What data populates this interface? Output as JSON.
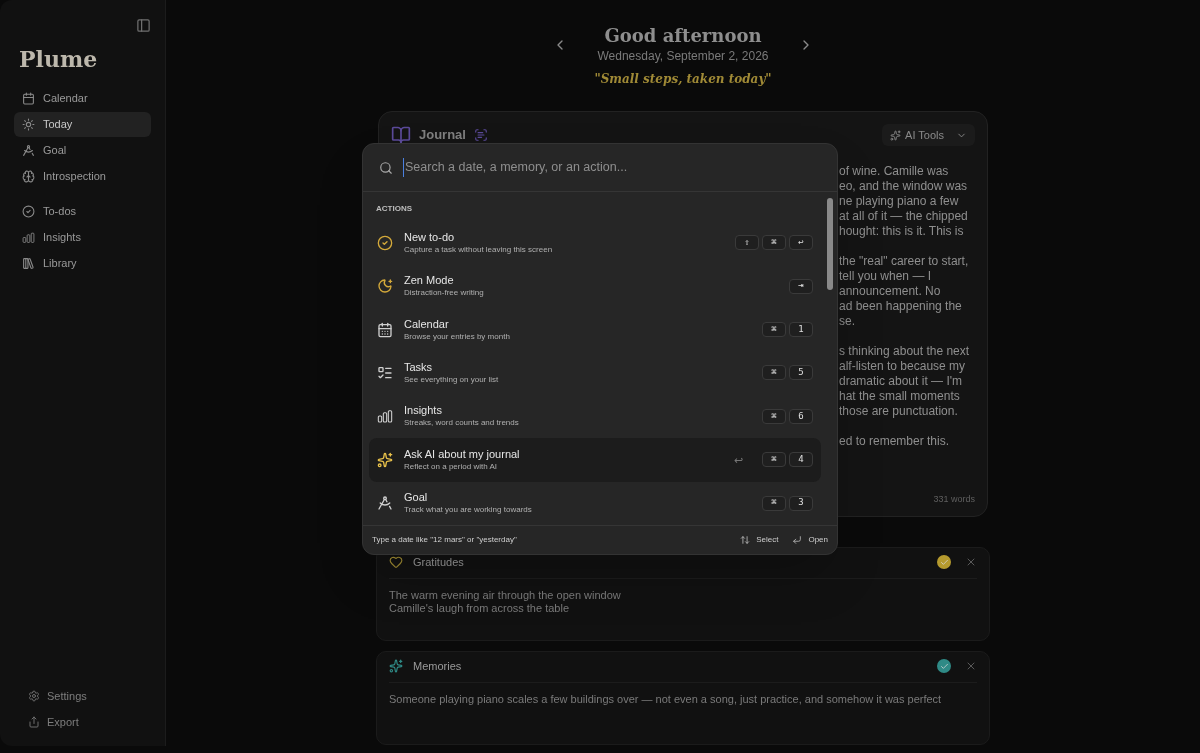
{
  "sidebar": {
    "logo": "Plume",
    "groups": [
      [
        {
          "kind": "calendar",
          "label": "Calendar",
          "selected": false
        },
        {
          "kind": "sun",
          "label": "Today",
          "selected": true
        },
        {
          "kind": "compass",
          "label": "Goal",
          "selected": false
        },
        {
          "kind": "brain",
          "label": "Introspection",
          "selected": false
        }
      ],
      [
        {
          "kind": "check",
          "label": "To-dos",
          "selected": false
        },
        {
          "kind": "bars",
          "label": "Insights",
          "selected": false
        },
        {
          "kind": "library",
          "label": "Library",
          "selected": false
        }
      ]
    ],
    "footer": [
      {
        "kind": "settings",
        "label": "Settings"
      },
      {
        "kind": "share",
        "label": "Export"
      }
    ]
  },
  "header": {
    "greeting": "Good afternoon",
    "date": "Wednesday, September 2, 2026",
    "motto": "\"Small steps, taken today\""
  },
  "journal": {
    "title": "Journal",
    "ai_button": "AI Tools",
    "paragraphs": [
      [
        "of wine. Camille was",
        "eo, and the window was",
        "ne playing piano a few",
        "at all of it — the chipped",
        "hought: this is it. This is"
      ],
      [
        "the \"real\" career to start,",
        "tell you when — I",
        "announcement. No",
        "ad been happening the",
        "se."
      ],
      [
        "s thinking about the next",
        "alf-listen to because my",
        "dramatic about it — I'm",
        "hat the small moments",
        "those are punctuation."
      ],
      [
        "ed to remember this."
      ]
    ],
    "word_count": "331 words"
  },
  "sections": [
    {
      "kind": "heart",
      "title": "Gratitudes",
      "color": "#b59a2e",
      "checked": true,
      "lines": [
        "The warm evening air through the open window",
        "Camille's laugh from across the table"
      ]
    },
    {
      "kind": "sparkles",
      "title": "Memories",
      "color": "#2f8a86",
      "checked": true,
      "lines": [
        "Someone playing piano scales a few buildings over — not even a song, just practice, and somehow it was perfect"
      ]
    }
  ],
  "palette": {
    "placeholder": "Search a date, a memory, or an action...",
    "section_label": "ACTIONS",
    "enter_hint": "↩",
    "items": [
      {
        "kind": "check",
        "title": "New to-do",
        "subtitle": "Capture a task without leaving this screen",
        "keys": [
          "⇧",
          "⌘",
          "↩"
        ],
        "selected": false
      },
      {
        "kind": "moon",
        "title": "Zen Mode",
        "subtitle": "Distraction-free writing",
        "keys": [
          "⇥"
        ],
        "selected": false
      },
      {
        "kind": "calgrid",
        "title": "Calendar",
        "subtitle": "Browse your entries by month",
        "keys": [
          "⌘",
          "1"
        ],
        "selected": false
      },
      {
        "kind": "tasks",
        "title": "Tasks",
        "subtitle": "See everything on your list",
        "keys": [
          "⌘",
          "5"
        ],
        "selected": false
      },
      {
        "kind": "bars",
        "title": "Insights",
        "subtitle": "Streaks, word counts and trends",
        "keys": [
          "⌘",
          "6"
        ],
        "selected": false
      },
      {
        "kind": "sparkles",
        "title": "Ask AI about my journal",
        "subtitle": "Reflect on a period with AI",
        "keys": [
          "⌘",
          "4"
        ],
        "selected": true
      },
      {
        "kind": "compass",
        "title": "Goal",
        "subtitle": "Track what you are working towards",
        "keys": [
          "⌘",
          "3"
        ],
        "selected": false
      }
    ],
    "footer": {
      "hint": "Type a date like \"12 mars\" or \"yesterday\"",
      "select": "Select",
      "open": "Open"
    }
  }
}
